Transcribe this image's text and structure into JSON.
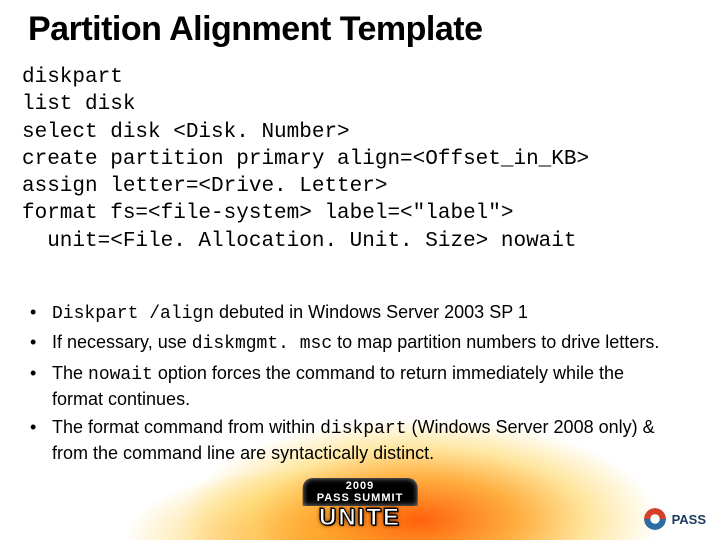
{
  "title": "Partition Alignment Template",
  "code_lines": [
    "diskpart",
    "list disk",
    "select disk <Disk. Number>",
    "create partition primary align=<Offset_in_KB>",
    "assign letter=<Drive. Letter>",
    "format fs=<file-system> label=<\"label\">",
    "  unit=<File. Allocation. Unit. Size> nowait"
  ],
  "bullets": [
    {
      "pre_mono": "Diskpart /align",
      "post": " debuted in Windows Server 2003 SP 1"
    },
    {
      "pre": "If necessary, use ",
      "mono": "diskmgmt. msc",
      "post": " to map partition numbers to drive letters."
    },
    {
      "pre": "The ",
      "mono": "nowait",
      "post": " option forces the command to return immediately while the format continues."
    },
    {
      "pre": "The format command from within ",
      "mono": "diskpart",
      "post": " (Windows Server 2008 only) & from the command line are syntactically distinct."
    }
  ],
  "badge": {
    "year": "2009",
    "line1": "PASS SUMMIT",
    "line2": "UNITE"
  },
  "logo_text": "PASS"
}
